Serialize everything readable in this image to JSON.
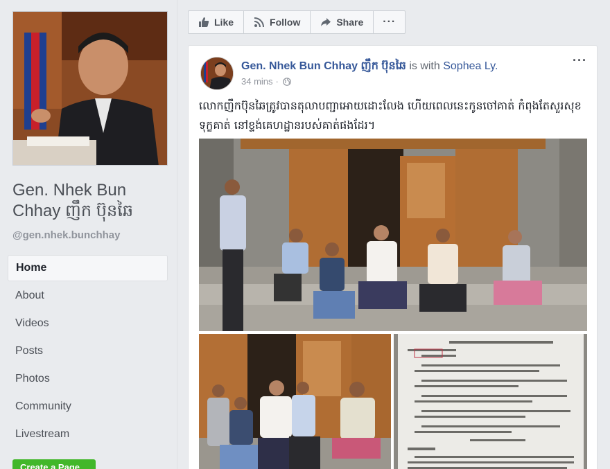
{
  "sidebar": {
    "page_name": "Gen. Nhek Bun Chhay ញឹក ប៊ុនឆៃ",
    "handle": "@gen.nhek.bunchhay",
    "nav": [
      {
        "label": "Home",
        "active": true
      },
      {
        "label": "About",
        "active": false
      },
      {
        "label": "Videos",
        "active": false
      },
      {
        "label": "Posts",
        "active": false
      },
      {
        "label": "Photos",
        "active": false
      },
      {
        "label": "Community",
        "active": false
      },
      {
        "label": "Livestream",
        "active": false
      }
    ],
    "create_page_label": "Create a Page"
  },
  "actions": {
    "like_label": "Like",
    "follow_label": "Follow",
    "share_label": "Share",
    "more_label": "···"
  },
  "post": {
    "author": "Gen. Nhek Bun Chhay ញឹក ប៊ុនឆៃ",
    "with_text": "is with",
    "tagged": "Sophea Ly.",
    "time": "34 mins",
    "more_label": "···",
    "text": "លោកញឹកប៊ុនឆៃត្រូវបានតុលាបញ្ជាអោយដោះលែង ហើយពេលនេះកូនចៅគាត់ កំពុងតែសួរសុខទុក្ខគាត់ នៅខ្ទង់គេហដ្ឋានរបស់គាត់ផងដែរ។"
  },
  "colors": {
    "link": "#365899",
    "create_button": "#42b72a",
    "background": "#e9ebee"
  }
}
